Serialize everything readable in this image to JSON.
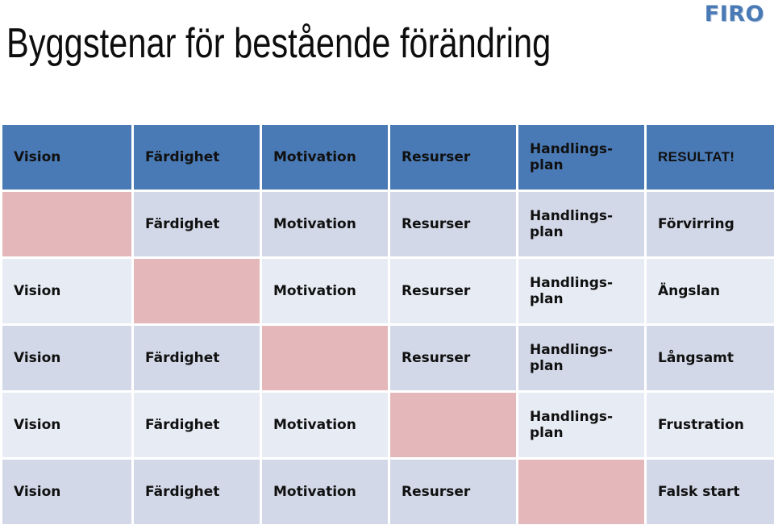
{
  "header": {
    "title": "Byggstenar för bestående förändring",
    "logo": "FIRO"
  },
  "colors": {
    "header_blue": "#4a7ab5",
    "row_shade_dark": "#d2d8e7",
    "row_shade_light": "#e7ebf4",
    "missing_pink": "#e4b8bb",
    "result_text_blue": "#6f9bd1",
    "logo_blue": "#4a7ab5"
  },
  "matrix": {
    "columns": [
      "Vision",
      "Färdighet",
      "Motivation",
      "Resurser",
      "Handlings-\nplan",
      "RESULTAT!"
    ],
    "rows": [
      {
        "shade": "head",
        "cells": [
          {
            "label": "Vision",
            "missing": false
          },
          {
            "label": "Färdighet",
            "missing": false
          },
          {
            "label": "Motivation",
            "missing": false
          },
          {
            "label": "Resurser",
            "missing": false
          },
          {
            "label": "Handlings-\nplan",
            "missing": false
          },
          {
            "label": "RESULTAT!",
            "missing": false
          }
        ]
      },
      {
        "shade": "shade-a",
        "cells": [
          {
            "label": "",
            "missing": true
          },
          {
            "label": "Färdighet",
            "missing": false
          },
          {
            "label": "Motivation",
            "missing": false
          },
          {
            "label": "Resurser",
            "missing": false
          },
          {
            "label": "Handlings-\nplan",
            "missing": false
          },
          {
            "label": "Förvirring",
            "missing": false
          }
        ]
      },
      {
        "shade": "shade-b",
        "cells": [
          {
            "label": "Vision",
            "missing": false
          },
          {
            "label": "",
            "missing": true
          },
          {
            "label": "Motivation",
            "missing": false
          },
          {
            "label": "Resurser",
            "missing": false
          },
          {
            "label": "Handlings-\nplan",
            "missing": false
          },
          {
            "label": "Ängslan",
            "missing": false
          }
        ]
      },
      {
        "shade": "shade-a",
        "cells": [
          {
            "label": "Vision",
            "missing": false
          },
          {
            "label": "Färdighet",
            "missing": false
          },
          {
            "label": "",
            "missing": true
          },
          {
            "label": "Resurser",
            "missing": false
          },
          {
            "label": "Handlings-\nplan",
            "missing": false
          },
          {
            "label": "Långsamt",
            "missing": false
          }
        ]
      },
      {
        "shade": "shade-b",
        "cells": [
          {
            "label": "Vision",
            "missing": false
          },
          {
            "label": "Färdighet",
            "missing": false
          },
          {
            "label": "Motivation",
            "missing": false
          },
          {
            "label": "",
            "missing": true
          },
          {
            "label": "Handlings-\nplan",
            "missing": false
          },
          {
            "label": "Frustration",
            "missing": false
          }
        ]
      },
      {
        "shade": "shade-a",
        "cells": [
          {
            "label": "Vision",
            "missing": false
          },
          {
            "label": "Färdighet",
            "missing": false
          },
          {
            "label": "Motivation",
            "missing": false
          },
          {
            "label": "Resurser",
            "missing": false
          },
          {
            "label": "",
            "missing": true
          },
          {
            "label": "Falsk start",
            "missing": false
          }
        ]
      }
    ]
  }
}
